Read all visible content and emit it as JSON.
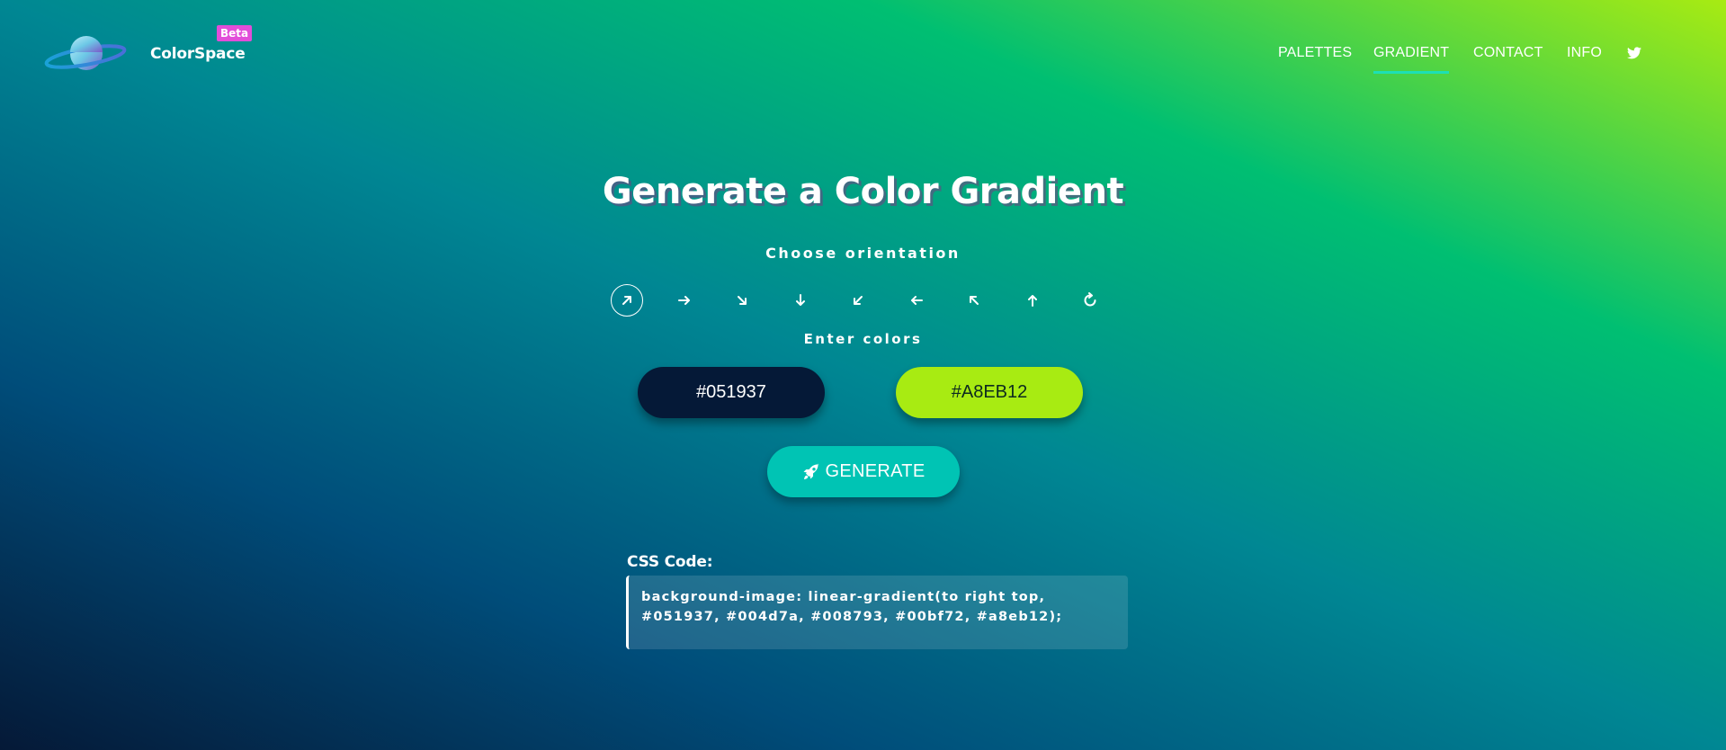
{
  "header": {
    "brand": "ColorSpace",
    "badge": "Beta",
    "nav": [
      {
        "label": "PALETTES",
        "active": false
      },
      {
        "label": "GRADIENT",
        "active": true
      },
      {
        "label": "CONTACT",
        "active": false
      },
      {
        "label": "INFO",
        "active": false
      }
    ],
    "social_icon": "twitter-icon"
  },
  "main": {
    "title": "Generate a Color Gradient",
    "orientation_label": "Choose orientation",
    "orientations": [
      {
        "icon": "arrow-up-right-icon",
        "active": true
      },
      {
        "icon": "arrow-right-icon",
        "active": false
      },
      {
        "icon": "arrow-down-right-icon",
        "active": false
      },
      {
        "icon": "arrow-down-icon",
        "active": false
      },
      {
        "icon": "arrow-down-left-icon",
        "active": false
      },
      {
        "icon": "arrow-left-icon",
        "active": false
      },
      {
        "icon": "arrow-up-left-icon",
        "active": false
      },
      {
        "icon": "arrow-up-icon",
        "active": false
      },
      {
        "icon": "radial-refresh-icon",
        "active": false
      }
    ],
    "colors_label": "Enter colors",
    "color_1": "#051937",
    "color_2": "#A8EB12",
    "generate_label": "GENERATE",
    "generate_icon": "rocket-icon",
    "css_heading": "CSS Code:",
    "css_code": "background-image: linear-gradient(to right top, #051937, #004d7a, #008793, #00bf72, #a8eb12);"
  },
  "colors": {
    "accent": "#1de0b5",
    "badge": "#e24dd9",
    "button": "#00c4b4"
  }
}
